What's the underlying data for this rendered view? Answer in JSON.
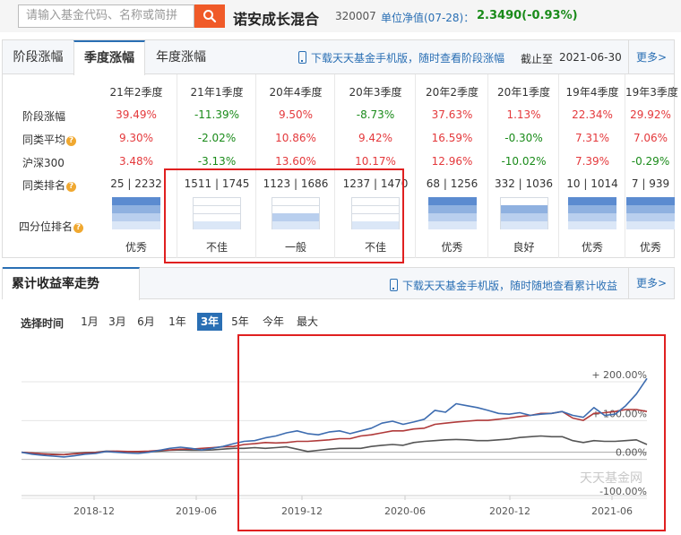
{
  "header": {
    "search_placeholder": "请输入基金代码、名称或简拼",
    "fund_name": "诺安成长混合",
    "fund_code": "320007",
    "nav_label": "单位净值(07-28)：",
    "nav_value": "2.3490(-0.93%)"
  },
  "perf": {
    "tabs": [
      "阶段涨幅",
      "季度涨幅",
      "年度涨幅"
    ],
    "active_tab": "季度涨幅",
    "download_text": "下载天天基金手机版，随时查看阶段涨幅",
    "asof_label": "截止至",
    "asof_date": "2021-06-30",
    "more": "更多>",
    "columns": [
      "21年2季度",
      "21年1季度",
      "20年4季度",
      "20年3季度",
      "20年2季度",
      "20年1季度",
      "19年4季度",
      "19年3季度"
    ],
    "row_labels": {
      "gain": "阶段涨幅",
      "peer_avg": "同类平均",
      "hs300": "沪深300",
      "rank": "同类排名",
      "quartile": "四分位排名"
    },
    "gain": [
      "39.49%",
      "-11.39%",
      "9.50%",
      "-8.73%",
      "37.63%",
      "1.13%",
      "22.34%",
      "29.92%"
    ],
    "peer_avg": [
      "9.30%",
      "-2.02%",
      "10.86%",
      "9.42%",
      "16.59%",
      "-0.30%",
      "7.31%",
      "7.06%"
    ],
    "hs300": [
      "3.48%",
      "-3.13%",
      "13.60%",
      "10.17%",
      "12.96%",
      "-10.02%",
      "7.39%",
      "-0.29%"
    ],
    "rank": [
      "25 | 2232",
      "1511 | 1745",
      "1123 | 1686",
      "1237 | 1470",
      "68 | 1256",
      "332 | 1036",
      "10 | 1014",
      "7 | 939"
    ],
    "quartile": [
      "优秀",
      "不佳",
      "一般",
      "不佳",
      "优秀",
      "良好",
      "优秀",
      "优秀"
    ],
    "quartile_level": [
      4,
      1,
      2,
      1,
      4,
      3,
      4,
      4
    ]
  },
  "trend": {
    "title": "累计收益率走势",
    "download_text": "下载天天基金手机版，随时随地查看累计收益",
    "more": "更多>",
    "select_label": "选择时间",
    "ranges": [
      "1月",
      "3月",
      "6月",
      "1年",
      "3年",
      "5年",
      "今年",
      "最大"
    ],
    "active_range": "3年",
    "watermark": "天天基金网"
  },
  "chart_data": {
    "type": "line",
    "x_ticks": [
      "2018-12",
      "2019-06",
      "2019-12",
      "2020-06",
      "2020-12",
      "2021-06"
    ],
    "y_ticks": [
      "+ 200.00%",
      "+ 100.00%",
      "0.00%",
      "-100.00%"
    ],
    "ylim": [
      -100,
      200
    ],
    "grid": true,
    "colors": {
      "fund": "#3d6cb0",
      "peer": "#b03a3a",
      "hs300": "#555555"
    },
    "series": [
      {
        "key": "fund",
        "values": [
          0,
          -5,
          -8,
          -10,
          -12,
          -9,
          -5,
          -3,
          2,
          0,
          -2,
          -3,
          0,
          5,
          10,
          13,
          10,
          6,
          10,
          15,
          22,
          28,
          30,
          37,
          42,
          50,
          55,
          48,
          45,
          52,
          55,
          48,
          55,
          62,
          75,
          80,
          72,
          78,
          85,
          108,
          103,
          125,
          120,
          115,
          108,
          100,
          98,
          102,
          95,
          98,
          100,
          105,
          95,
          90,
          115,
          95,
          98,
          120,
          150,
          190
        ]
      },
      {
        "key": "peer",
        "values": [
          0,
          -2,
          -4,
          -6,
          -6,
          -4,
          -2,
          -1,
          2,
          3,
          2,
          2,
          3,
          5,
          6,
          8,
          8,
          10,
          12,
          14,
          15,
          20,
          22,
          25,
          24,
          25,
          28,
          28,
          30,
          32,
          35,
          35,
          42,
          45,
          50,
          55,
          55,
          60,
          62,
          72,
          75,
          78,
          80,
          82,
          82,
          85,
          88,
          92,
          95,
          100,
          100,
          105,
          88,
          82,
          100,
          102,
          105,
          110,
          110,
          105
        ]
      },
      {
        "key": "hs300",
        "values": [
          0,
          -2,
          -4,
          -5,
          -6,
          -3,
          -1,
          0,
          3,
          2,
          2,
          1,
          1,
          3,
          5,
          6,
          5,
          5,
          6,
          8,
          10,
          10,
          12,
          10,
          12,
          14,
          8,
          2,
          5,
          8,
          10,
          10,
          10,
          15,
          18,
          20,
          18,
          25,
          28,
          30,
          32,
          33,
          32,
          30,
          30,
          32,
          34,
          38,
          40,
          42,
          40,
          40,
          30,
          25,
          30,
          28,
          28,
          30,
          32,
          20
        ]
      }
    ]
  }
}
